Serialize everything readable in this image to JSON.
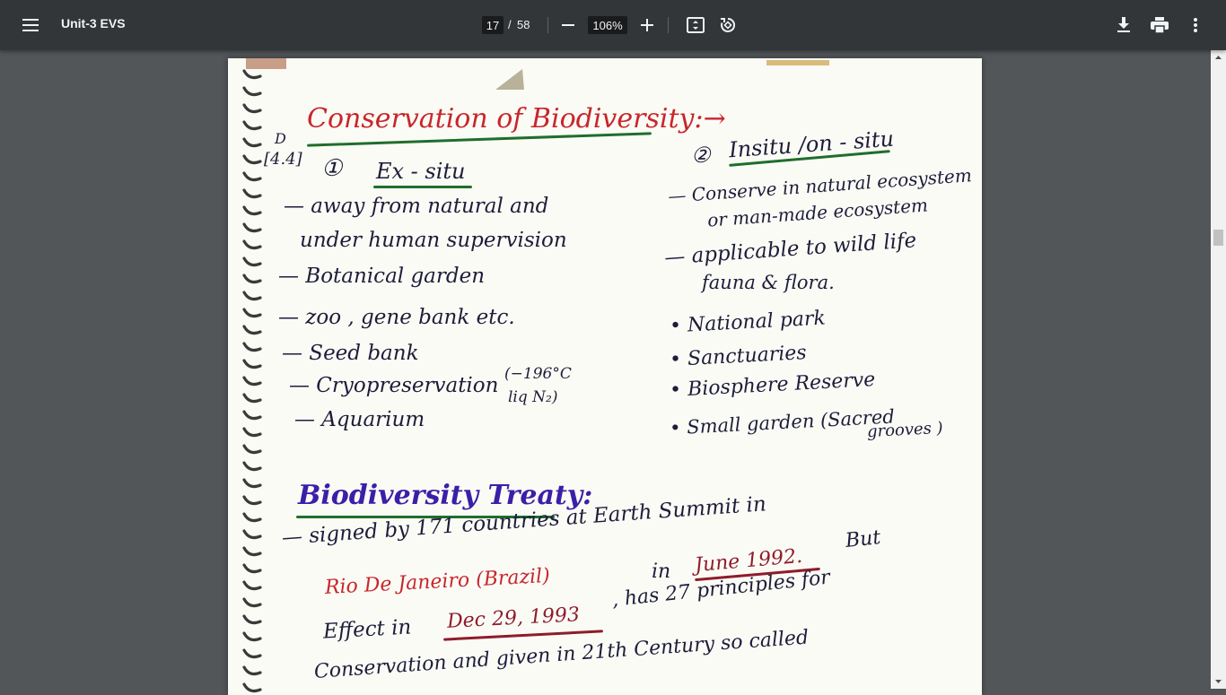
{
  "toolbar": {
    "title": "Unit-3 EVS",
    "current_page": "17",
    "page_separator": "/",
    "total_pages": "58",
    "zoom": "106%",
    "icons": [
      "menu-icon",
      "minus-icon",
      "plus-icon",
      "fit-page-icon",
      "rotate-icon",
      "download-icon",
      "print-icon",
      "more-vertical-icon"
    ]
  },
  "notes": {
    "mark1": "D",
    "mark2": "[4.4]",
    "heading": "Conservation of Biodiversity:→",
    "left": {
      "num": "①",
      "title": "Ex - situ",
      "lines": [
        "— away from natural and",
        "under human supervision",
        "— Botanical garden",
        "— zoo , gene bank etc.",
        "— Seed bank",
        "— Cryopreservation",
        "— Aquarium"
      ],
      "cryo_1": "(−196°C",
      "cryo_2": "liq N₂)"
    },
    "right": {
      "num": "②",
      "title": "Insitu /on - situ",
      "lines": [
        "— Conserve in natural ecosystem",
        "or man-made ecosystem",
        "— applicable to wild life",
        "fauna & flora.",
        "• National park",
        "• Sanctuaries",
        "• Biosphere Reserve",
        "• Small garden (Sacred",
        "grooves )"
      ]
    },
    "treaty": {
      "heading": "Biodiversity Treaty:",
      "l1": "— signed by 171 countries at Earth Summit in",
      "l2a": "Rio De Janeiro (Brazil)",
      "l2b": "in",
      "l2c": "June 1992.",
      "l2d": "But",
      "l3a": "Effect in",
      "l3b": "Dec 29, 1993",
      "l3c": ", has 27 principles for",
      "l4": "Conservation and given in 21th Century so called"
    },
    "colors": {
      "red": "#c8262b",
      "green": "#1f6e2c",
      "purple": "#3b1fa8",
      "maroon": "#8e1c2a",
      "ink": "#1d1d3a"
    }
  }
}
